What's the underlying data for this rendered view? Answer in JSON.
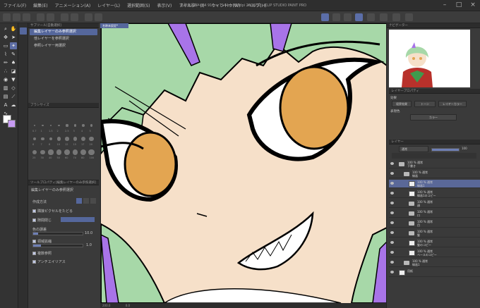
{
  "window": {
    "title": "名称未設定* (64 911 × 714 px 350dpi 200.0%) - CLIP STUDIO PAINT PRO"
  },
  "menu": [
    "ファイル(F)",
    "編集(E)",
    "アニメーション(A)",
    "レイヤー(L)",
    "選択範囲(S)",
    "表示(V)",
    "フィルター(I)",
    "ウィンドウ(W)",
    "ヘルプ(H)"
  ],
  "subtool": {
    "header": "サブツール[自動選択]",
    "items": [
      "編集レイヤーのみ参照選択",
      "他レイヤーを参照選択",
      "参照レイヤー用選択"
    ],
    "selected_index": 0
  },
  "brush_size": {
    "header": "ブラシサイズ",
    "labels": [
      "0.7",
      "1",
      "1.5",
      "2",
      "2.5",
      "3",
      "4",
      "5",
      "6",
      "7",
      "8",
      "10",
      "12",
      "15",
      "17",
      "20",
      "25",
      "30",
      "40",
      "50",
      "60",
      "70",
      "80",
      "100"
    ]
  },
  "tool_property": {
    "header": "ツールプロパティ[編集レイヤーのみ参照選択]",
    "title": "編集レイヤーのみ参照選択",
    "rows": [
      {
        "label": "作成方法",
        "checked": false
      },
      {
        "label": "隣接ピクセルをたどる",
        "checked": true
      },
      {
        "label": "隙間閉じ",
        "checked": true
      },
      {
        "label": "色の誤差",
        "checked": false,
        "value": "10.0"
      },
      {
        "label": "領域拡縮",
        "checked": true,
        "value": "1.0"
      },
      {
        "label": "複数参照",
        "checked": true
      },
      {
        "label": "アンチエイリアス",
        "checked": true
      }
    ]
  },
  "navigator": {
    "header": "ナビゲーター"
  },
  "layer_property": {
    "header": "レイヤープロパティ",
    "effect": "効果",
    "border": "境界効果",
    "tone": "トーン",
    "layer_color": "レイヤーカラー",
    "expression_label": "表現色",
    "expression_value": "カラー"
  },
  "layers": {
    "header": "レイヤー",
    "blend_mode": "通常",
    "opacity": "100",
    "rows": [
      {
        "name": "100 % 通常\n下書き",
        "type": "folder",
        "indent": 0
      },
      {
        "name": "100 % 通常\n線画",
        "type": "folder",
        "indent": 1
      },
      {
        "name": "100 % 通常\n線画1",
        "type": "layer",
        "indent": 2,
        "selected": true
      },
      {
        "name": "100 % 通常\n線画1のコピー",
        "type": "layer",
        "indent": 2
      },
      {
        "name": "100 % 通常\n顔",
        "type": "folder",
        "indent": 2
      },
      {
        "name": "100 % 通常\n口",
        "type": "folder",
        "indent": 2
      },
      {
        "name": "100 % 通常\n目",
        "type": "folder",
        "indent": 2
      },
      {
        "name": "100 % 通常\n髪",
        "type": "folder",
        "indent": 2
      },
      {
        "name": "100 % 通常\n髪のコピー",
        "type": "layer",
        "indent": 2
      },
      {
        "name": "100 % 通常\nベースのコピー",
        "type": "layer",
        "indent": 2
      },
      {
        "name": "100 % 通常\n線画1",
        "type": "folder",
        "indent": 1
      },
      {
        "name": "用紙",
        "type": "paper",
        "indent": 0
      }
    ]
  },
  "canvas": {
    "tab": "名称未設定*"
  },
  "statusbar": {
    "zoom": "200.0",
    "angle": "0.0"
  },
  "colors": {
    "accent": "#5a6898",
    "skin": "#f6e0c9",
    "hair": "#a7d8a8",
    "purple": "#a874e8",
    "eye": "#e3a551"
  }
}
